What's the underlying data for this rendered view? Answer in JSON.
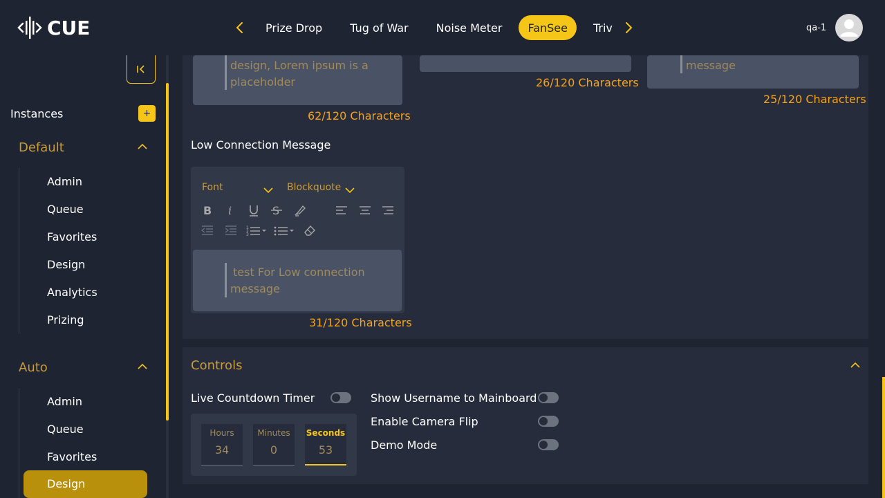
{
  "header": {
    "logo_text": "CUE",
    "tabs": [
      {
        "label": "Prize Drop"
      },
      {
        "label": "Tug of War"
      },
      {
        "label": "Noise Meter"
      },
      {
        "label": "FanSee",
        "active": true
      },
      {
        "label": "Trivia"
      }
    ],
    "user_name": "qa-1",
    "accent_color": "#f5c518"
  },
  "sidebar": {
    "instances_label": "Instances",
    "add_label": "+",
    "groups": [
      {
        "title": "Default",
        "items": [
          "Admin",
          "Queue",
          "Favorites",
          "Design",
          "Analytics",
          "Prizing"
        ]
      },
      {
        "title": "Auto",
        "items": [
          "Admin",
          "Queue",
          "Favorites",
          "Design"
        ],
        "active_item": "Design"
      }
    ]
  },
  "messages": {
    "first_text_line1": "design, Lorem ipsum is a",
    "first_text_line2": "placeholder",
    "first_count": "62/120 Characters",
    "second_count": "26/120 Characters",
    "third_text": "message",
    "third_count": "25/120 Characters",
    "low_connection_label": "Low Connection Message",
    "editor_font": "Font",
    "editor_block": "Blockquote",
    "low_connection_line1": "test For Low connection",
    "low_connection_line2": "message",
    "low_connection_count": "31/120 Characters"
  },
  "controls": {
    "title": "Controls",
    "live_countdown_label": "Live Countdown Timer",
    "show_username_label": "Show Username to Mainboard",
    "camera_flip_label": "Enable Camera Flip",
    "demo_mode_label": "Demo Mode",
    "hours_label": "Hours",
    "hours_value": "34",
    "minutes_label": "Minutes",
    "minutes_value": "0",
    "seconds_label": "Seconds",
    "seconds_value": "53"
  }
}
